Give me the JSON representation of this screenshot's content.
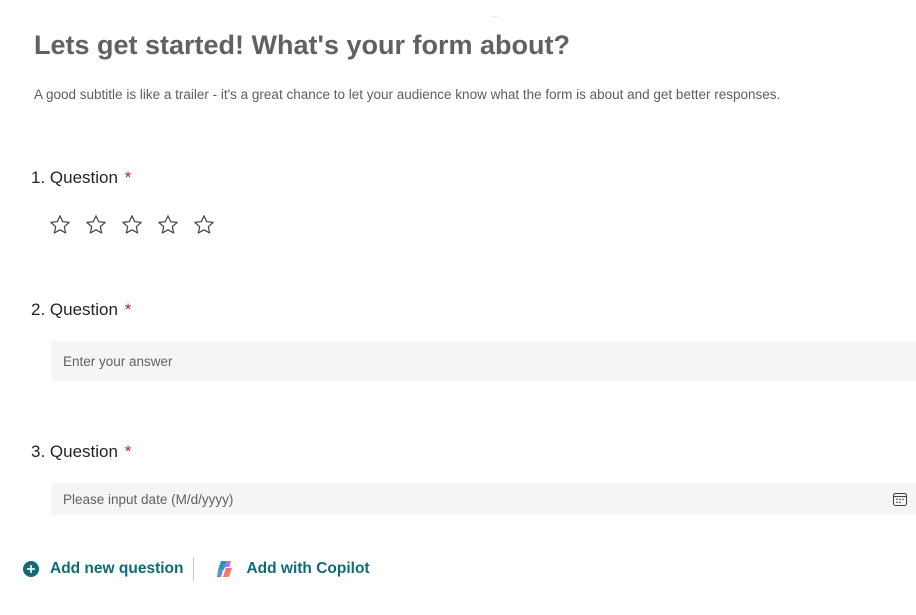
{
  "form": {
    "title": "Lets get started! What's your form about?",
    "subtitle": "A good subtitle is like a trailer - it's a great chance to let your audience know what the form is about and get better responses."
  },
  "questions": [
    {
      "number": "1.",
      "title": "Question",
      "required_marker": "*",
      "type": "rating",
      "rating_max": 5,
      "rating_value": 0
    },
    {
      "number": "2.",
      "title": "Question",
      "required_marker": "*",
      "type": "text",
      "placeholder": "Enter your answer"
    },
    {
      "number": "3.",
      "title": "Question",
      "required_marker": "*",
      "type": "date",
      "placeholder": "Please input date (M/d/yyyy)"
    }
  ],
  "actions": {
    "add_new_question": "Add new question",
    "add_with_copilot": "Add with Copilot"
  },
  "colors": {
    "accent": "#0f6c74",
    "required": "#a4262c",
    "title": "#616161",
    "input_bg": "#f5f5f5"
  },
  "icons": [
    "star-icon",
    "calendar-icon",
    "add-circle-icon",
    "copilot-icon"
  ]
}
